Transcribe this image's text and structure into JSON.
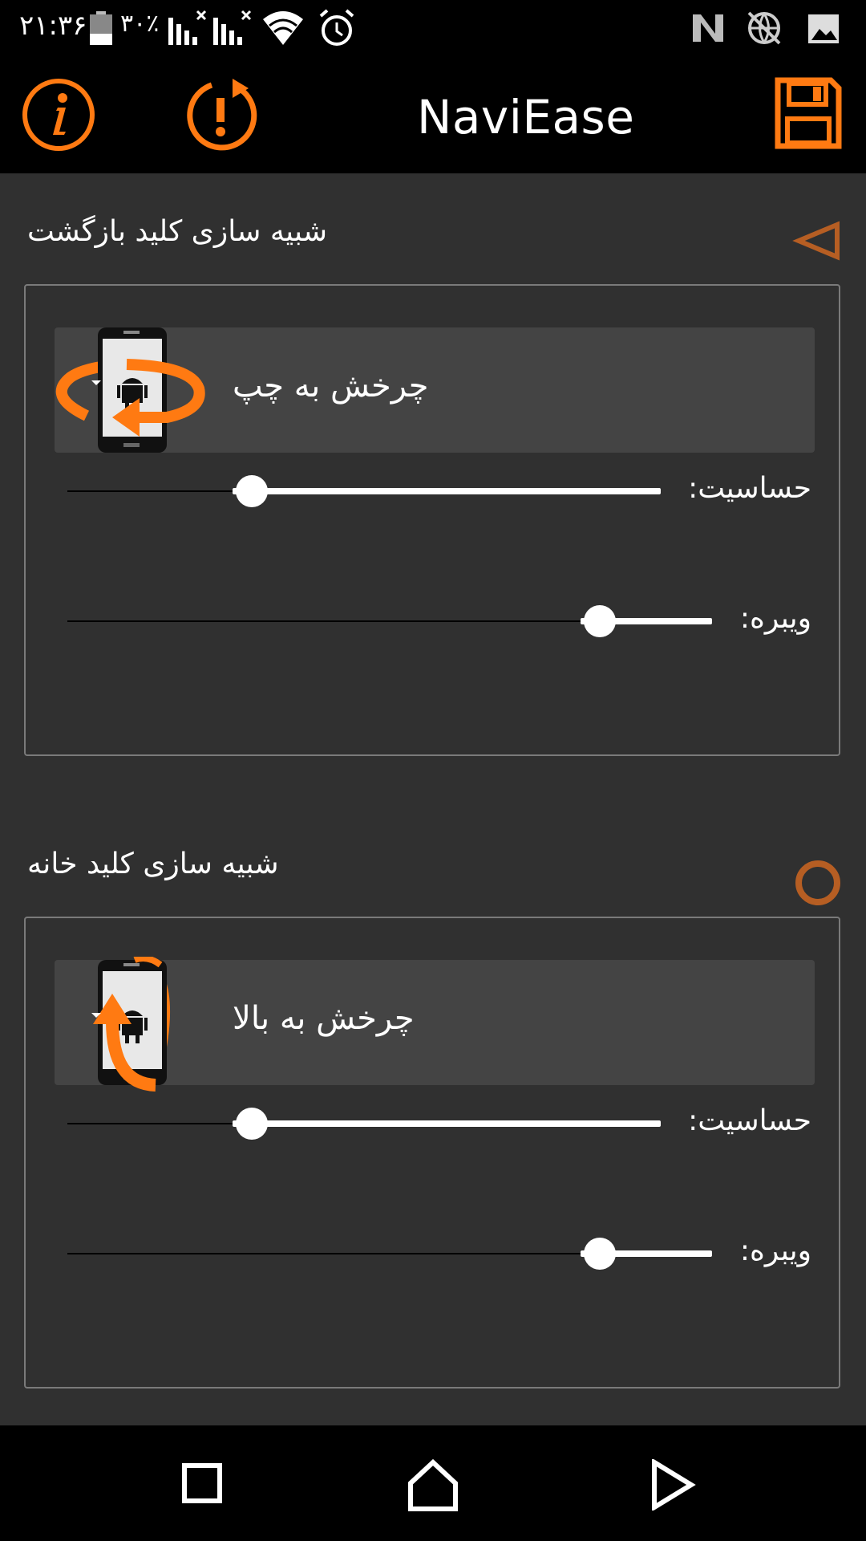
{
  "status_bar": {
    "time": "۲۱:۳۶",
    "battery_percent": "۳۰٪",
    "icons": [
      "battery-icon",
      "signal-1-icon",
      "signal-2-icon",
      "wifi-icon",
      "alarm-icon",
      "n-notification-icon",
      "no-network-icon",
      "image-icon"
    ]
  },
  "app_bar": {
    "title": "NaviEase",
    "info_icon": "info-icon",
    "power_icon": "power-restart-icon",
    "save_icon": "save-icon",
    "accent": "#FF7A12"
  },
  "sections": [
    {
      "title": "شبیه سازی کلید بازگشت",
      "icon": "back-triangle-icon",
      "gesture": "چرخش به چپ",
      "gesture_icon": "rotate-left-phone-icon",
      "sensitivity_label": "حساسیت:",
      "sensitivity_value": 0.7,
      "vibration_label": "ویبره:",
      "vibration_value": 0.18
    },
    {
      "title": "شبیه سازی کلید خانه",
      "icon": "home-circle-icon",
      "gesture": "چرخش به بالا",
      "gesture_icon": "rotate-up-phone-icon",
      "sensitivity_label": "حساسیت:",
      "sensitivity_value": 0.7,
      "vibration_label": "ویبره:",
      "vibration_value": 0.18
    }
  ],
  "nav_bar": {
    "icons": [
      "recents-square-icon",
      "home-outline-icon",
      "back-triangle-nav-icon"
    ]
  }
}
